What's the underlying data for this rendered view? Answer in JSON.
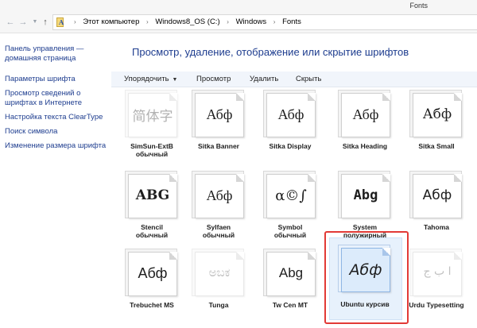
{
  "window": {
    "title": "Fonts"
  },
  "address": {
    "crumbs": [
      "Этот компьютер",
      "Windows8_OS (C:)",
      "Windows",
      "Fonts"
    ]
  },
  "sidebar": {
    "items": [
      {
        "label": "Панель управления — домашняя страница"
      },
      {
        "label": "Параметры шрифта"
      },
      {
        "label": "Просмотр сведений о шрифтах в Интернете"
      },
      {
        "label": "Настройка текста ClearType"
      },
      {
        "label": "Поиск символа"
      },
      {
        "label": "Изменение размера шрифта"
      }
    ]
  },
  "main": {
    "heading": "Просмотр, удаление, отображение или скрытие шрифтов",
    "toolbar": {
      "organize": "Упорядочить",
      "preview": "Просмотр",
      "delete": "Удалить",
      "hide": "Скрыть"
    }
  },
  "fonts": [
    {
      "name": "SimSun-ExtB",
      "style": "обычный",
      "sample": "简体字"
    },
    {
      "name": "Sitka Banner",
      "style": "",
      "sample": "Абф"
    },
    {
      "name": "Sitka Display",
      "style": "",
      "sample": "Абф"
    },
    {
      "name": "Sitka Heading",
      "style": "",
      "sample": "Абф"
    },
    {
      "name": "Sitka Small",
      "style": "",
      "sample": "Абф"
    },
    {
      "name": "Stencil",
      "style": "обычный",
      "sample": "ABG"
    },
    {
      "name": "Sylfaen",
      "style": "обычный",
      "sample": "Абф"
    },
    {
      "name": "Symbol",
      "style": "обычный",
      "sample": "α©∫"
    },
    {
      "name": "System",
      "style": "полужирный",
      "sample": "Abg"
    },
    {
      "name": "Tahoma",
      "style": "",
      "sample": "Абф"
    },
    {
      "name": "Trebuchet MS",
      "style": "",
      "sample": "Абф"
    },
    {
      "name": "Tunga",
      "style": "",
      "sample": "ಅಬಕ"
    },
    {
      "name": "Tw Cen MT",
      "style": "",
      "sample": "Abg"
    },
    {
      "name": "Ubuntu курсив",
      "style": "",
      "sample": "Абф"
    },
    {
      "name": "Urdu Typesetting",
      "style": "",
      "sample": "ا ب ج"
    }
  ],
  "colors": {
    "link": "#1e3d8f",
    "selection": "#dcebfb",
    "highlight": "#e23a36"
  }
}
